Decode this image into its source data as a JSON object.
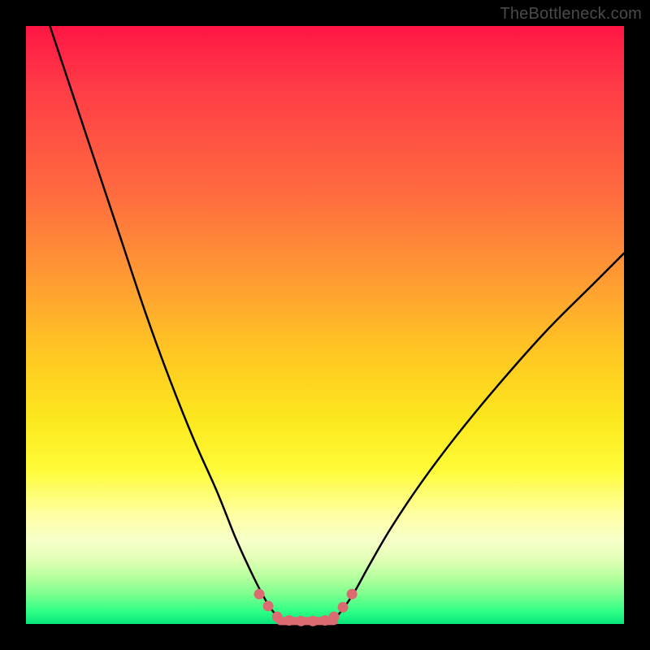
{
  "watermark": "TheBottleneck.com",
  "colors": {
    "frame": "#000000",
    "curve": "#000000",
    "markers": "#db6b70",
    "gradient_top": "#ff1544",
    "gradient_bottom": "#07e47a"
  },
  "chart_data": {
    "type": "line",
    "title": "",
    "xlabel": "",
    "ylabel": "",
    "xlim": [
      0,
      100
    ],
    "ylim": [
      0,
      100
    ],
    "series": [
      {
        "name": "left-curve",
        "x": [
          4,
          8,
          12,
          16,
          20,
          24,
          28,
          32,
          35,
          37.5,
          39.5,
          41,
          42.5
        ],
        "y": [
          100,
          88,
          76,
          64,
          52,
          41,
          31,
          22,
          14.5,
          9,
          5,
          2.5,
          0.8
        ]
      },
      {
        "name": "right-curve",
        "x": [
          51.5,
          53,
          55,
          57.5,
          61,
          66,
          72,
          79,
          87,
          95,
          100
        ],
        "y": [
          0.8,
          2.5,
          5.5,
          10,
          16,
          23.5,
          31.5,
          40,
          49,
          57,
          62
        ]
      },
      {
        "name": "flat-bottom",
        "x": [
          42.5,
          51.5
        ],
        "y": [
          0.5,
          0.5
        ]
      }
    ],
    "markers": {
      "name": "bottom-dots",
      "points": [
        {
          "x": 39.0,
          "y": 5.0
        },
        {
          "x": 40.5,
          "y": 3.0
        },
        {
          "x": 42.0,
          "y": 1.2
        },
        {
          "x": 44.0,
          "y": 0.6
        },
        {
          "x": 46.0,
          "y": 0.5
        },
        {
          "x": 48.0,
          "y": 0.5
        },
        {
          "x": 50.0,
          "y": 0.6
        },
        {
          "x": 51.5,
          "y": 1.2
        },
        {
          "x": 53.0,
          "y": 2.8
        },
        {
          "x": 54.5,
          "y": 5.0
        }
      ]
    }
  }
}
